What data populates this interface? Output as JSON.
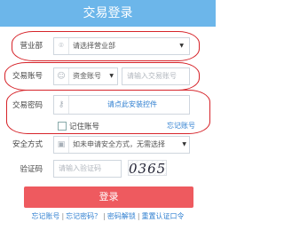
{
  "header": {
    "title": "交易登录"
  },
  "rows": {
    "department": {
      "label": "营业部",
      "placeholder": "请选择营业部",
      "icon": "location-pin-icon"
    },
    "account": {
      "label": "交易账号",
      "type_value": "资金账号",
      "input_placeholder": "请输入交易账号",
      "icon": "user-icon"
    },
    "password": {
      "label": "交易密码",
      "control_text": "请点此安装控件",
      "icon": "key-icon"
    },
    "remember": {
      "label": "记住账号",
      "forgot_account": "忘记账号"
    },
    "security": {
      "label": "安全方式",
      "value": "如未申请安全方式，无需选择",
      "icon": "lock-icon"
    },
    "captcha": {
      "label": "验证码",
      "placeholder": "请输入验证码",
      "image_text": "0365"
    }
  },
  "login_button": "登录",
  "footer": {
    "forgot_account": "忘记账号",
    "forgot_password": "忘记密码？",
    "password_unlock": "密码解锁",
    "reset_auth": "重置认证口令",
    "separator": "|"
  },
  "colors": {
    "header": "#6cb6ea",
    "button": "#ee5a5f",
    "highlight_oval": "#d6242a",
    "link": "#2f7fd0"
  }
}
